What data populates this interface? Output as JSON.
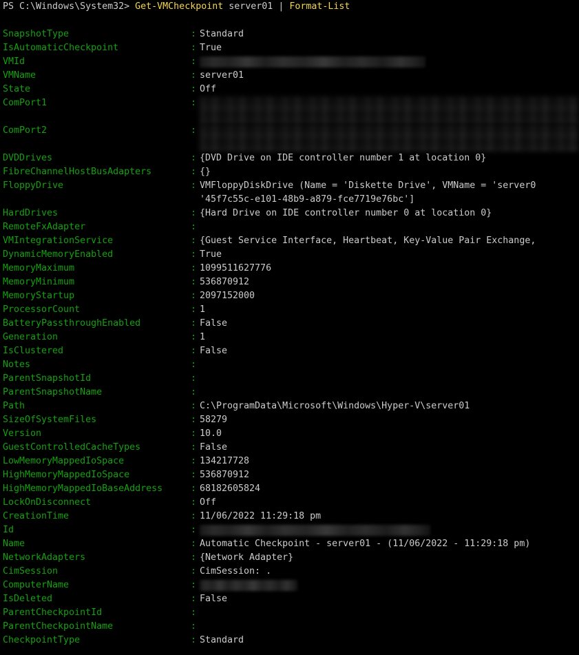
{
  "terminal": {
    "shell": "PowerShell",
    "background_color": "#000000",
    "property_name_color": "#13a10e",
    "value_color": "#cccccc",
    "cmdlet_color": "#f3d64e"
  },
  "prompt": {
    "label": "PS C:\\Windows\\System32>",
    "cmdlet": "Get-VMCheckpoint",
    "argument": "server01",
    "pipe": "|",
    "formatter": "Format-List"
  },
  "properties": [
    {
      "name": "SnapshotType",
      "value": "Standard"
    },
    {
      "name": "IsAutomaticCheckpoint",
      "value": "True"
    },
    {
      "name": "VMId",
      "value": "",
      "redacted": true,
      "redact_width": 328
    },
    {
      "name": "VMName",
      "value": "server01"
    },
    {
      "name": "State",
      "value": "Off"
    },
    {
      "name": "ComPort1",
      "value": "",
      "redacted_block": true
    },
    {
      "name": "ComPort2",
      "value": "",
      "redacted_block": true
    },
    {
      "name": "DVDDrives",
      "value": "{DVD Drive on IDE controller number 1 at location 0}"
    },
    {
      "name": "FibreChannelHostBusAdapters",
      "value": "{}"
    },
    {
      "name": "FloppyDrive",
      "value": "VMFloppyDiskDrive (Name = 'Diskette Drive', VMName = 'server0",
      "continuation": "'45f7c55c-e101-48b9-a879-fce7719e76bc']"
    },
    {
      "name": "HardDrives",
      "value": "{Hard Drive on IDE controller number 0 at location 0}"
    },
    {
      "name": "RemoteFxAdapter",
      "value": ""
    },
    {
      "name": "VMIntegrationService",
      "value": "{Guest Service Interface, Heartbeat, Key-Value Pair Exchange,"
    },
    {
      "name": "DynamicMemoryEnabled",
      "value": "True"
    },
    {
      "name": "MemoryMaximum",
      "value": "1099511627776"
    },
    {
      "name": "MemoryMinimum",
      "value": "536870912"
    },
    {
      "name": "MemoryStartup",
      "value": "2097152000"
    },
    {
      "name": "ProcessorCount",
      "value": "1"
    },
    {
      "name": "BatteryPassthroughEnabled",
      "value": "False"
    },
    {
      "name": "Generation",
      "value": "1"
    },
    {
      "name": "IsClustered",
      "value": "False"
    },
    {
      "name": "Notes",
      "value": ""
    },
    {
      "name": "ParentSnapshotId",
      "value": ""
    },
    {
      "name": "ParentSnapshotName",
      "value": ""
    },
    {
      "name": "Path",
      "value": "C:\\ProgramData\\Microsoft\\Windows\\Hyper-V\\server01"
    },
    {
      "name": "SizeOfSystemFiles",
      "value": "58279"
    },
    {
      "name": "Version",
      "value": "10.0"
    },
    {
      "name": "GuestControlledCacheTypes",
      "value": "False"
    },
    {
      "name": "LowMemoryMappedIoSpace",
      "value": "134217728"
    },
    {
      "name": "HighMemoryMappedIoSpace",
      "value": "536870912"
    },
    {
      "name": "HighMemoryMappedIoBaseAddress",
      "value": "68182605824"
    },
    {
      "name": "LockOnDisconnect",
      "value": "Off"
    },
    {
      "name": "CreationTime",
      "value": "11/06/2022 11:29:18 pm"
    },
    {
      "name": "Id",
      "value": "",
      "redacted": true,
      "redact_width": 335
    },
    {
      "name": "Name",
      "value": "Automatic Checkpoint - server01 - (11/06/2022 - 11:29:18 pm)"
    },
    {
      "name": "NetworkAdapters",
      "value": "{Network Adapter}"
    },
    {
      "name": "CimSession",
      "value": "CimSession: ."
    },
    {
      "name": "ComputerName",
      "value": "",
      "redacted": true,
      "redact_width": 142
    },
    {
      "name": "IsDeleted",
      "value": "False"
    },
    {
      "name": "ParentCheckpointId",
      "value": ""
    },
    {
      "name": "ParentCheckpointName",
      "value": ""
    },
    {
      "name": "CheckpointType",
      "value": "Standard"
    }
  ]
}
